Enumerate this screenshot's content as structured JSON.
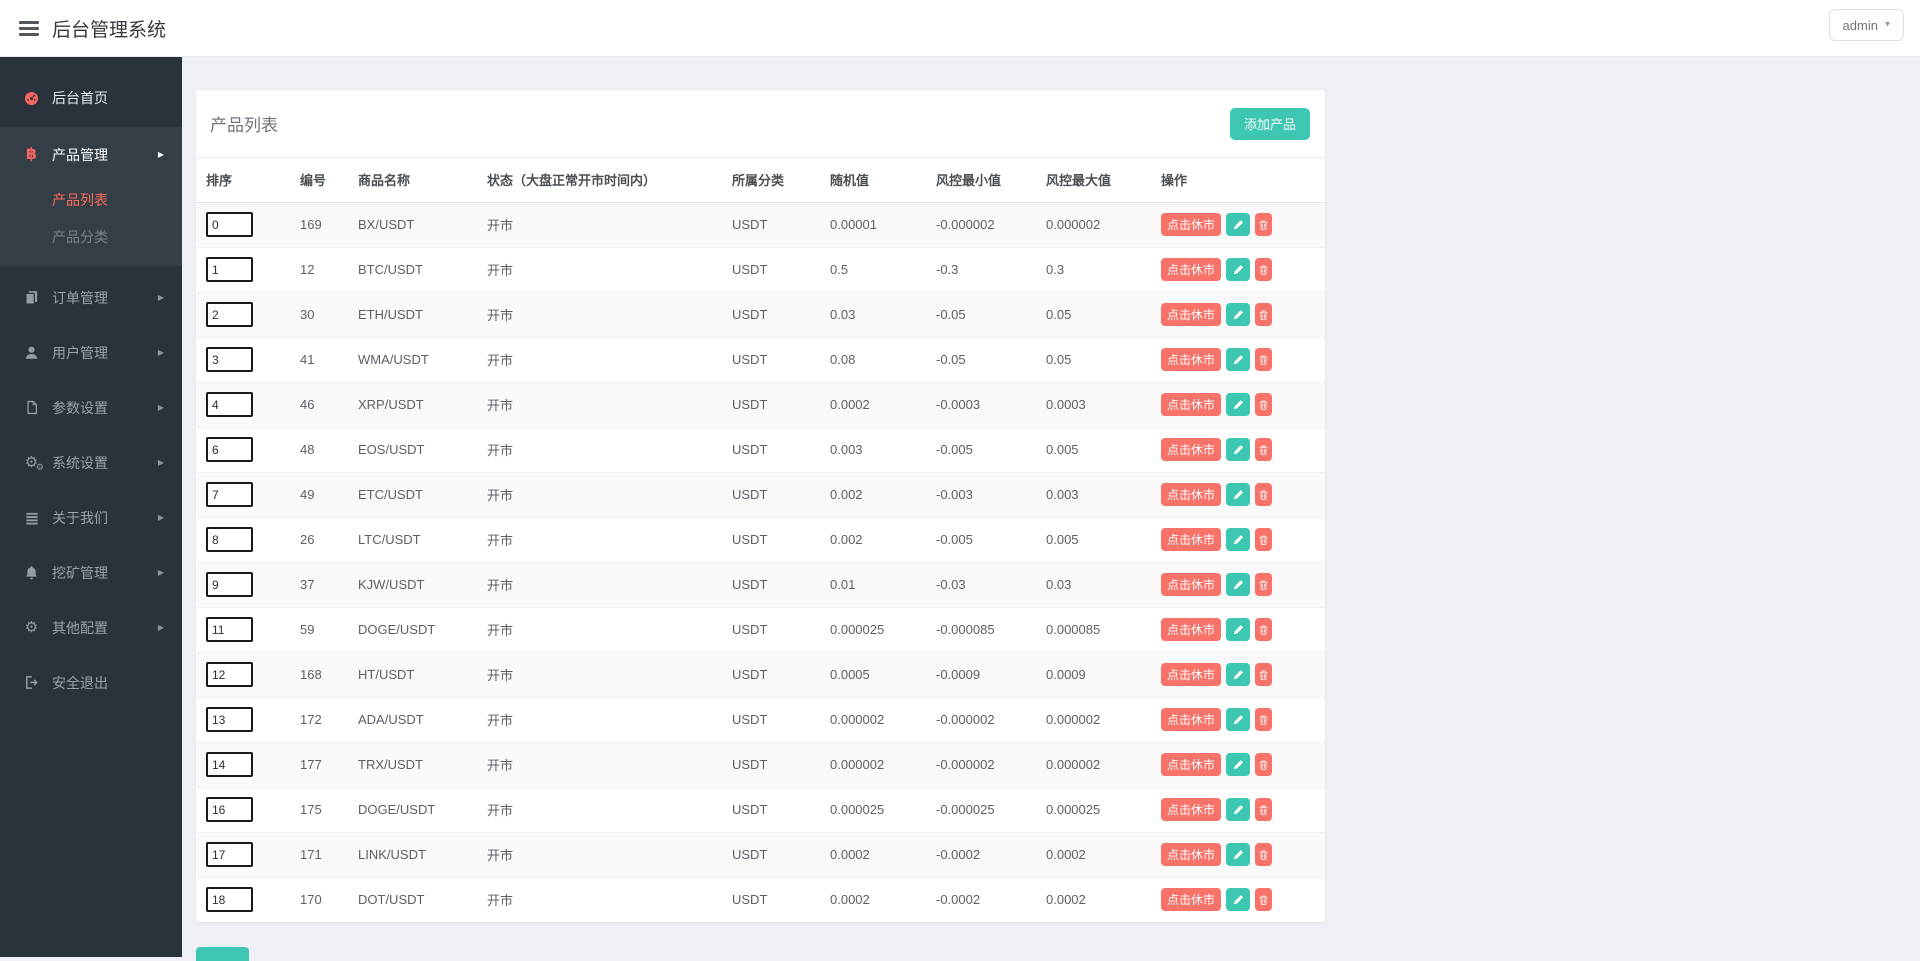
{
  "header": {
    "title": "后台管理系统",
    "user_menu_label": "admin"
  },
  "sidebar": {
    "items": [
      {
        "label": "后台首页"
      },
      {
        "label": "产品管理",
        "expanded": true,
        "submenu": [
          {
            "label": "产品列表",
            "active": true
          },
          {
            "label": "产品分类",
            "active": false
          }
        ]
      },
      {
        "label": "订单管理"
      },
      {
        "label": "用户管理"
      },
      {
        "label": "参数设置"
      },
      {
        "label": "系统设置"
      },
      {
        "label": "关于我们"
      },
      {
        "label": "挖矿管理"
      },
      {
        "label": "其他配置"
      },
      {
        "label": "安全退出"
      }
    ]
  },
  "main": {
    "card_title": "产品列表",
    "add_button_label": "添加产品",
    "table": {
      "columns": [
        "排序",
        "编号",
        "商品名称",
        "状态（大盘正常开市时间内）",
        "所属分类",
        "随机值",
        "风控最小值",
        "风控最大值",
        "操作"
      ],
      "action_buttons": {
        "toggle_label": "点击休市",
        "edit_icon": "pencil-icon",
        "delete_icon": "trash-icon"
      },
      "rows": [
        {
          "sort": "0",
          "id": "169",
          "name": "BX/USDT",
          "status": "开市",
          "category": "USDT",
          "random": "0.00001",
          "risk_min": "-0.000002",
          "risk_max": "0.000002"
        },
        {
          "sort": "1",
          "id": "12",
          "name": "BTC/USDT",
          "status": "开市",
          "category": "USDT",
          "random": "0.5",
          "risk_min": "-0.3",
          "risk_max": "0.3"
        },
        {
          "sort": "2",
          "id": "30",
          "name": "ETH/USDT",
          "status": "开市",
          "category": "USDT",
          "random": "0.03",
          "risk_min": "-0.05",
          "risk_max": "0.05"
        },
        {
          "sort": "3",
          "id": "41",
          "name": "WMA/USDT",
          "status": "开市",
          "category": "USDT",
          "random": "0.08",
          "risk_min": "-0.05",
          "risk_max": "0.05"
        },
        {
          "sort": "4",
          "id": "46",
          "name": "XRP/USDT",
          "status": "开市",
          "category": "USDT",
          "random": "0.0002",
          "risk_min": "-0.0003",
          "risk_max": "0.0003"
        },
        {
          "sort": "6",
          "id": "48",
          "name": "EOS/USDT",
          "status": "开市",
          "category": "USDT",
          "random": "0.003",
          "risk_min": "-0.005",
          "risk_max": "0.005"
        },
        {
          "sort": "7",
          "id": "49",
          "name": "ETC/USDT",
          "status": "开市",
          "category": "USDT",
          "random": "0.002",
          "risk_min": "-0.003",
          "risk_max": "0.003"
        },
        {
          "sort": "8",
          "id": "26",
          "name": "LTC/USDT",
          "status": "开市",
          "category": "USDT",
          "random": "0.002",
          "risk_min": "-0.005",
          "risk_max": "0.005"
        },
        {
          "sort": "9",
          "id": "37",
          "name": "KJW/USDT",
          "status": "开市",
          "category": "USDT",
          "random": "0.01",
          "risk_min": "-0.03",
          "risk_max": "0.03"
        },
        {
          "sort": "11",
          "id": "59",
          "name": "DOGE/USDT",
          "status": "开市",
          "category": "USDT",
          "random": "0.000025",
          "risk_min": "-0.000085",
          "risk_max": "0.000085"
        },
        {
          "sort": "12",
          "id": "168",
          "name": "HT/USDT",
          "status": "开市",
          "category": "USDT",
          "random": "0.0005",
          "risk_min": "-0.0009",
          "risk_max": "0.0009"
        },
        {
          "sort": "13",
          "id": "172",
          "name": "ADA/USDT",
          "status": "开市",
          "category": "USDT",
          "random": "0.000002",
          "risk_min": "-0.000002",
          "risk_max": "0.000002"
        },
        {
          "sort": "14",
          "id": "177",
          "name": "TRX/USDT",
          "status": "开市",
          "category": "USDT",
          "random": "0.000002",
          "risk_min": "-0.000002",
          "risk_max": "0.000002"
        },
        {
          "sort": "16",
          "id": "175",
          "name": "DOGE/USDT",
          "status": "开市",
          "category": "USDT",
          "random": "0.000025",
          "risk_min": "-0.000025",
          "risk_max": "0.000025"
        },
        {
          "sort": "17",
          "id": "171",
          "name": "LINK/USDT",
          "status": "开市",
          "category": "USDT",
          "random": "0.0002",
          "risk_min": "-0.0002",
          "risk_max": "0.0002"
        },
        {
          "sort": "18",
          "id": "170",
          "name": "DOT/USDT",
          "status": "开市",
          "category": "USDT",
          "random": "0.0002",
          "risk_min": "-0.0002",
          "risk_max": "0.0002"
        }
      ]
    }
  },
  "colors": {
    "accent_teal": "#3dc7b3",
    "accent_salmon": "#f7736a",
    "accent_red": "#f4655f",
    "sidebar_bg": "#2a333c",
    "sidebar_group_bg": "#343e47",
    "page_bg": "#eef0f5"
  }
}
